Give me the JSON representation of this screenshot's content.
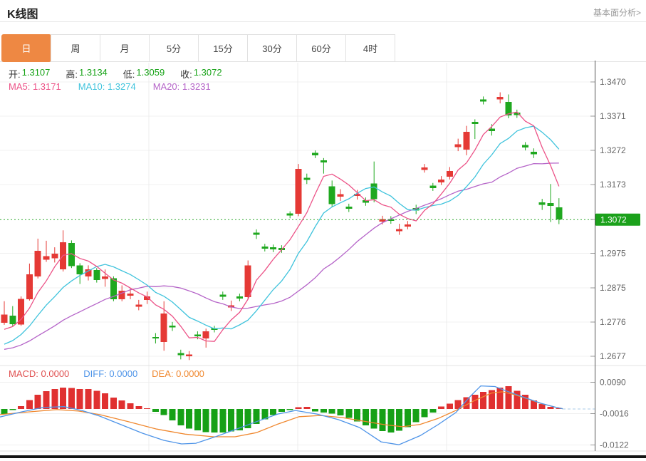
{
  "header": {
    "title": "K线图",
    "link": "基本面分析>"
  },
  "tabs": {
    "items": [
      "日",
      "周",
      "月",
      "5分",
      "15分",
      "30分",
      "60分",
      "4时"
    ],
    "selected_index": 0
  },
  "main": {
    "ohlc": [
      {
        "label": "开:",
        "value": "1.3107"
      },
      {
        "label": "高:",
        "value": "1.3134"
      },
      {
        "label": "低:",
        "value": "1.3059"
      },
      {
        "label": "收:",
        "value": "1.3072"
      }
    ],
    "ma": [
      {
        "label": "MA5:",
        "value": "1.3171"
      },
      {
        "label": "MA10:",
        "value": "1.3274"
      },
      {
        "label": "MA20:",
        "value": "1.3231"
      }
    ]
  },
  "macd_row": [
    {
      "label": "MACD:",
      "value": "0.0000"
    },
    {
      "label": "DIFF:",
      "value": "0.0000"
    },
    {
      "label": "DEA:",
      "value": "0.0000"
    }
  ],
  "colors": {
    "up": "#E53935",
    "down": "#1FA81F",
    "ma5": "#EC5287",
    "ma10": "#3FC3DC",
    "ma20": "#B564C8",
    "tab_accent": "#EE8843",
    "price_tag": "#1BA11B",
    "dotted_current": "#2FA82F",
    "diff_line": "#4E94E8",
    "dea_line": "#F0882F",
    "hist_up": "#E03030",
    "hist_down": "#16A016",
    "dashed_zero": "#A9CBE9",
    "grid": "#f0f0f0",
    "vgrid": "#ececec",
    "border": "#e3e3e3",
    "axis_line": "#555",
    "axis_text": "#666",
    "bottom_bar": "#151515"
  },
  "chart_data": {
    "type": "candlestick+macd",
    "ylim": [
      1.2677,
      1.347
    ],
    "current_price": 1.3072,
    "current_price_text": "1.3072",
    "price_ticks": [
      {
        "text": "1.3470",
        "price": 1.347
      },
      {
        "text": "1.3371",
        "price": 1.3371
      },
      {
        "text": "1.3272",
        "price": 1.3272
      },
      {
        "text": "1.3173",
        "price": 1.3173
      },
      {
        "text": "1.3072",
        "price": 1.3072
      },
      {
        "text": "1.2975",
        "price": 1.2975
      },
      {
        "text": "1.2875",
        "price": 1.2875
      },
      {
        "text": "1.2776",
        "price": 1.2776
      },
      {
        "text": "1.2677",
        "price": 1.2677
      }
    ],
    "candle_format": "[open, close, high, low]",
    "candles": [
      [
        1.2774,
        1.2798,
        1.2836,
        1.2768
      ],
      [
        1.2794,
        1.277,
        1.2822,
        1.2764
      ],
      [
        1.2769,
        1.2843,
        1.285,
        1.2765
      ],
      [
        1.2842,
        1.2914,
        1.2945,
        1.2838
      ],
      [
        1.2908,
        1.2982,
        1.3017,
        1.2902
      ],
      [
        1.2956,
        1.2966,
        1.3011,
        1.295
      ],
      [
        1.296,
        1.2974,
        1.2992,
        1.2948
      ],
      [
        1.2928,
        1.3007,
        1.3041,
        1.2922
      ],
      [
        1.3005,
        1.2938,
        1.3012,
        1.2932
      ],
      [
        1.294,
        1.2914,
        1.2946,
        1.2886
      ],
      [
        1.2908,
        1.2928,
        1.294,
        1.2896
      ],
      [
        1.2926,
        1.2897,
        1.2932,
        1.289
      ],
      [
        1.29,
        1.2908,
        1.2928,
        1.2878
      ],
      [
        1.2903,
        1.2842,
        1.2908,
        1.2836
      ],
      [
        1.2842,
        1.2867,
        1.2882,
        1.2836
      ],
      [
        1.2852,
        1.2858,
        1.2874,
        1.2842
      ],
      [
        1.282,
        1.2826,
        1.284,
        1.281
      ],
      [
        1.284,
        1.285,
        1.2864,
        1.2828
      ],
      [
        1.2733,
        1.2728,
        1.2744,
        1.2714
      ],
      [
        1.2718,
        1.2801,
        1.2836,
        1.2693
      ],
      [
        1.2766,
        1.276,
        1.2776,
        1.275
      ],
      [
        1.2686,
        1.268,
        1.2696,
        1.2668
      ],
      [
        1.2677,
        1.2682,
        1.2692,
        1.2666
      ],
      [
        1.274,
        1.2735,
        1.2749,
        1.2726
      ],
      [
        1.2728,
        1.2749,
        1.2757,
        1.2702
      ],
      [
        1.2758,
        1.2753,
        1.2765,
        1.2746
      ],
      [
        1.2855,
        1.2849,
        1.2864,
        1.284
      ],
      [
        1.2818,
        1.2824,
        1.2838,
        1.2808
      ],
      [
        1.285,
        1.2844,
        1.2858,
        1.2836
      ],
      [
        1.2848,
        1.294,
        1.2954,
        1.2842
      ],
      [
        1.3034,
        1.3028,
        1.3044,
        1.3016
      ],
      [
        1.2994,
        1.2988,
        1.3002,
        1.298
      ],
      [
        1.2992,
        1.2986,
        1.3,
        1.2978
      ],
      [
        1.299,
        1.2984,
        1.2998,
        1.2976
      ],
      [
        1.309,
        1.3084,
        1.3096,
        1.3076
      ],
      [
        1.3089,
        1.3219,
        1.3233,
        1.3082
      ],
      [
        1.3193,
        1.3187,
        1.3205,
        1.3175
      ],
      [
        1.3265,
        1.3258,
        1.3272,
        1.325
      ],
      [
        1.3243,
        1.3237,
        1.325,
        1.3205
      ],
      [
        1.3168,
        1.3117,
        1.3185,
        1.3108
      ],
      [
        1.3138,
        1.3146,
        1.316,
        1.3126
      ],
      [
        1.311,
        1.3103,
        1.3118,
        1.3094
      ],
      [
        1.314,
        1.3147,
        1.3158,
        1.313
      ],
      [
        1.3128,
        1.3121,
        1.3136,
        1.3112
      ],
      [
        1.3176,
        1.3131,
        1.324,
        1.3122
      ],
      [
        1.3066,
        1.3073,
        1.3083,
        1.3058
      ],
      [
        1.3074,
        1.3068,
        1.3082,
        1.306
      ],
      [
        1.3038,
        1.3045,
        1.306,
        1.3028
      ],
      [
        1.3052,
        1.3058,
        1.3068,
        1.3044
      ],
      [
        1.3105,
        1.3098,
        1.3115,
        1.3088
      ],
      [
        1.3216,
        1.3223,
        1.3233,
        1.3208
      ],
      [
        1.317,
        1.3163,
        1.3178,
        1.3155
      ],
      [
        1.318,
        1.3188,
        1.3198,
        1.3172
      ],
      [
        1.3196,
        1.3213,
        1.3224,
        1.3188
      ],
      [
        1.3282,
        1.329,
        1.3306,
        1.327
      ],
      [
        1.3274,
        1.3326,
        1.3343,
        1.3258
      ],
      [
        1.3355,
        1.3348,
        1.3362,
        1.3305
      ],
      [
        1.342,
        1.3413,
        1.3428,
        1.3405
      ],
      [
        1.3335,
        1.3328,
        1.3348,
        1.3315
      ],
      [
        1.342,
        1.3427,
        1.344,
        1.3408
      ],
      [
        1.3412,
        1.3373,
        1.3434,
        1.3365
      ],
      [
        1.3381,
        1.3374,
        1.339,
        1.3366
      ],
      [
        1.3288,
        1.3281,
        1.3296,
        1.3272
      ],
      [
        1.3268,
        1.3261,
        1.3278,
        1.325
      ],
      [
        1.3122,
        1.3115,
        1.3132,
        1.31
      ],
      [
        1.312,
        1.3112,
        1.3175,
        1.3065
      ],
      [
        1.3107,
        1.3072,
        1.3134,
        1.3059
      ]
    ],
    "ma_periods": [
      5,
      10,
      20
    ],
    "ma_seed": [
      1.268,
      1.2681,
      1.2682,
      1.2682,
      1.2682,
      1.2682,
      1.2682,
      1.2683,
      1.2683,
      1.2685,
      1.2665,
      1.2668,
      1.2669,
      1.267,
      1.2672,
      1.273,
      1.274,
      1.275,
      1.2756
    ],
    "macd": {
      "ticks": [
        {
          "text": "0.0090",
          "value": 0.009
        },
        {
          "text": "-0.0016",
          "value": -0.0016
        },
        {
          "text": "-0.0122",
          "value": -0.0122
        }
      ],
      "hist": [
        -0.0017,
        -0.0004,
        0.001,
        0.003,
        0.0048,
        0.006,
        0.0068,
        0.0072,
        0.0071,
        0.0068,
        0.0067,
        0.0062,
        0.0053,
        0.0038,
        0.0029,
        0.0019,
        0.001,
        0.0002,
        -0.001,
        -0.002,
        -0.0038,
        -0.0055,
        -0.0066,
        -0.0072,
        -0.0078,
        -0.008,
        -0.0079,
        -0.0076,
        -0.0072,
        -0.0065,
        -0.005,
        -0.0035,
        -0.002,
        -0.001,
        -0.0004,
        0.0006,
        0.0007,
        -0.0008,
        -0.0012,
        -0.0016,
        -0.0022,
        -0.003,
        -0.0042,
        -0.0055,
        -0.0066,
        -0.0075,
        -0.008,
        -0.0074,
        -0.0062,
        -0.0045,
        -0.0028,
        -0.0012,
        0.0008,
        0.0018,
        0.003,
        0.004,
        0.0048,
        0.0058,
        0.0064,
        0.0072,
        0.0077,
        0.0062,
        0.0048,
        0.0029,
        0.0017,
        0.0007,
        0.0002
      ],
      "diff": [
        [
          0,
          -0.0027
        ],
        [
          30,
          -0.001
        ],
        [
          60,
          0.0005
        ],
        [
          90,
          0.0008
        ],
        [
          115,
          -0.0005
        ],
        [
          140,
          -0.0024
        ],
        [
          170,
          -0.0053
        ],
        [
          200,
          -0.0082
        ],
        [
          230,
          -0.0106
        ],
        [
          255,
          -0.0118
        ],
        [
          275,
          -0.0116
        ],
        [
          300,
          -0.0096
        ],
        [
          330,
          -0.007
        ],
        [
          360,
          -0.0043
        ],
        [
          390,
          -0.0017
        ],
        [
          415,
          -0.0005
        ],
        [
          445,
          -0.0017
        ],
        [
          475,
          -0.0036
        ],
        [
          505,
          -0.0063
        ],
        [
          535,
          -0.0111
        ],
        [
          560,
          -0.0121
        ],
        [
          590,
          -0.009
        ],
        [
          615,
          -0.0053
        ],
        [
          640,
          -0.0012
        ],
        [
          660,
          0.0042
        ],
        [
          675,
          0.0078
        ],
        [
          695,
          0.0076
        ],
        [
          710,
          0.0062
        ],
        [
          735,
          0.004
        ],
        [
          760,
          0.0019
        ],
        [
          780,
          0.0006
        ],
        [
          790,
          0.0001
        ]
      ],
      "dea": [
        [
          0,
          -0.0019
        ],
        [
          40,
          -0.001
        ],
        [
          80,
          -0.0002
        ],
        [
          110,
          -0.0007
        ],
        [
          140,
          -0.0019
        ],
        [
          180,
          -0.0043
        ],
        [
          220,
          -0.0068
        ],
        [
          260,
          -0.0085
        ],
        [
          300,
          -0.0094
        ],
        [
          330,
          -0.0094
        ],
        [
          360,
          -0.008
        ],
        [
          390,
          -0.0051
        ],
        [
          420,
          -0.0026
        ],
        [
          450,
          -0.0022
        ],
        [
          480,
          -0.0029
        ],
        [
          510,
          -0.0041
        ],
        [
          540,
          -0.0053
        ],
        [
          565,
          -0.006
        ],
        [
          590,
          -0.0052
        ],
        [
          615,
          -0.0032
        ],
        [
          640,
          -0.0005
        ],
        [
          665,
          0.0027
        ],
        [
          690,
          0.0054
        ],
        [
          705,
          0.0058
        ],
        [
          720,
          0.005
        ],
        [
          740,
          0.0035
        ],
        [
          760,
          0.0018
        ],
        [
          780,
          0.0006
        ],
        [
          790,
          0.0001
        ]
      ]
    }
  }
}
